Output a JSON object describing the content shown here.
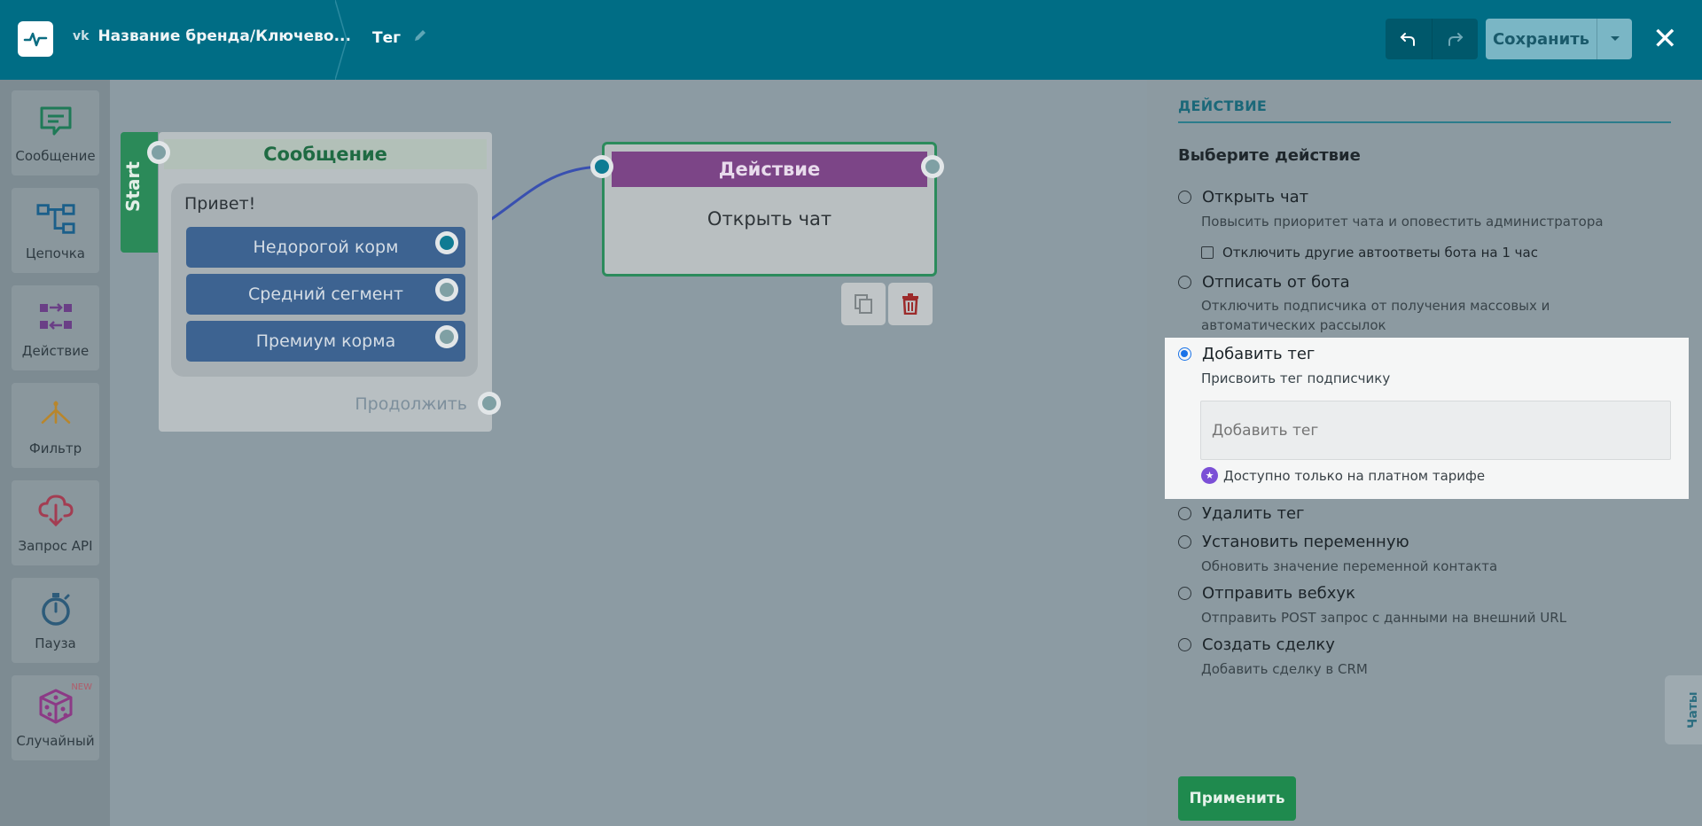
{
  "header": {
    "brand": "Название бренда/Ключево...",
    "title": "Тег",
    "save_label": "Сохранить"
  },
  "palette": [
    {
      "label": "Сообщение",
      "icon": "message-icon",
      "color": "#1f7a57"
    },
    {
      "label": "Цепочка",
      "icon": "chain-icon",
      "color": "#1b5f8a"
    },
    {
      "label": "Действие",
      "icon": "action-icon",
      "color": "#6a3f86"
    },
    {
      "label": "Фильтр",
      "icon": "filter-icon",
      "color": "#b8862c"
    },
    {
      "label": "Запрос API",
      "icon": "api-cloud-icon",
      "color": "#a33d52"
    },
    {
      "label": "Пауза",
      "icon": "stopwatch-icon",
      "color": "#2d5b7a"
    },
    {
      "label": "Случайный",
      "icon": "dice-icon",
      "color": "#8c3a86",
      "badge": "NEW"
    }
  ],
  "canvas": {
    "start_label": "Start",
    "message_node": {
      "title": "Сообщение",
      "text": "Привет!",
      "buttons": [
        "Недорогой корм",
        "Средний сегмент",
        "Премиум корма"
      ],
      "continue_label": "Продолжить"
    },
    "action_node": {
      "title": "Действие",
      "body": "Открыть чат"
    }
  },
  "panel": {
    "title": "ДЕЙСТВИЕ",
    "subtitle": "Выберите действие",
    "options": [
      {
        "label": "Открыть чат",
        "desc": "Повысить приоритет чата и оповестить администратора",
        "checked": false
      },
      {
        "label": "Отписать от бота",
        "desc": "Отключить подписчика от получения массовых и автоматических рассылок",
        "checked": false
      },
      {
        "label": "Добавить тег",
        "desc": "Присвоить тег подписчику",
        "checked": true
      },
      {
        "label": "Удалить тег",
        "desc": "",
        "checked": false
      },
      {
        "label": "Установить переменную",
        "desc": "Обновить значение переменной контакта",
        "checked": false
      },
      {
        "label": "Отправить вебхук",
        "desc": "Отправить POST запрос с данными на внешний URL",
        "checked": false
      },
      {
        "label": "Создать сделку",
        "desc": "Добавить сделку в CRM",
        "checked": false
      }
    ],
    "checkbox_label": "Отключить другие автоответы бота на 1 час",
    "tag_placeholder": "Добавить тег",
    "paid_note": "Доступно только на платном тарифе",
    "apply_label": "Применить",
    "chats_tab": "Чаты"
  }
}
